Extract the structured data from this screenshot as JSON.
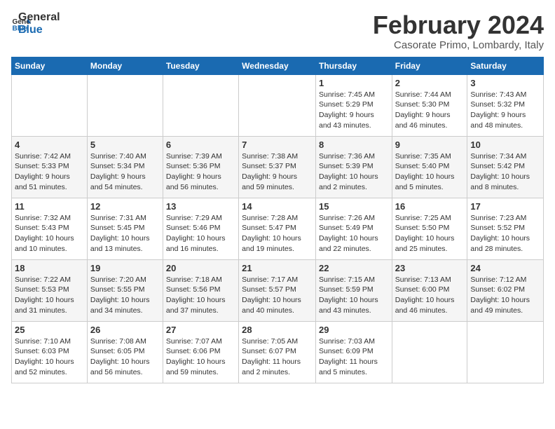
{
  "header": {
    "logo_line1": "General",
    "logo_line2": "Blue",
    "month": "February 2024",
    "location": "Casorate Primo, Lombardy, Italy"
  },
  "weekdays": [
    "Sunday",
    "Monday",
    "Tuesday",
    "Wednesday",
    "Thursday",
    "Friday",
    "Saturday"
  ],
  "weeks": [
    [
      {
        "day": "",
        "info": ""
      },
      {
        "day": "",
        "info": ""
      },
      {
        "day": "",
        "info": ""
      },
      {
        "day": "",
        "info": ""
      },
      {
        "day": "1",
        "info": "Sunrise: 7:45 AM\nSunset: 5:29 PM\nDaylight: 9 hours\nand 43 minutes."
      },
      {
        "day": "2",
        "info": "Sunrise: 7:44 AM\nSunset: 5:30 PM\nDaylight: 9 hours\nand 46 minutes."
      },
      {
        "day": "3",
        "info": "Sunrise: 7:43 AM\nSunset: 5:32 PM\nDaylight: 9 hours\nand 48 minutes."
      }
    ],
    [
      {
        "day": "4",
        "info": "Sunrise: 7:42 AM\nSunset: 5:33 PM\nDaylight: 9 hours\nand 51 minutes."
      },
      {
        "day": "5",
        "info": "Sunrise: 7:40 AM\nSunset: 5:34 PM\nDaylight: 9 hours\nand 54 minutes."
      },
      {
        "day": "6",
        "info": "Sunrise: 7:39 AM\nSunset: 5:36 PM\nDaylight: 9 hours\nand 56 minutes."
      },
      {
        "day": "7",
        "info": "Sunrise: 7:38 AM\nSunset: 5:37 PM\nDaylight: 9 hours\nand 59 minutes."
      },
      {
        "day": "8",
        "info": "Sunrise: 7:36 AM\nSunset: 5:39 PM\nDaylight: 10 hours\nand 2 minutes."
      },
      {
        "day": "9",
        "info": "Sunrise: 7:35 AM\nSunset: 5:40 PM\nDaylight: 10 hours\nand 5 minutes."
      },
      {
        "day": "10",
        "info": "Sunrise: 7:34 AM\nSunset: 5:42 PM\nDaylight: 10 hours\nand 8 minutes."
      }
    ],
    [
      {
        "day": "11",
        "info": "Sunrise: 7:32 AM\nSunset: 5:43 PM\nDaylight: 10 hours\nand 10 minutes."
      },
      {
        "day": "12",
        "info": "Sunrise: 7:31 AM\nSunset: 5:45 PM\nDaylight: 10 hours\nand 13 minutes."
      },
      {
        "day": "13",
        "info": "Sunrise: 7:29 AM\nSunset: 5:46 PM\nDaylight: 10 hours\nand 16 minutes."
      },
      {
        "day": "14",
        "info": "Sunrise: 7:28 AM\nSunset: 5:47 PM\nDaylight: 10 hours\nand 19 minutes."
      },
      {
        "day": "15",
        "info": "Sunrise: 7:26 AM\nSunset: 5:49 PM\nDaylight: 10 hours\nand 22 minutes."
      },
      {
        "day": "16",
        "info": "Sunrise: 7:25 AM\nSunset: 5:50 PM\nDaylight: 10 hours\nand 25 minutes."
      },
      {
        "day": "17",
        "info": "Sunrise: 7:23 AM\nSunset: 5:52 PM\nDaylight: 10 hours\nand 28 minutes."
      }
    ],
    [
      {
        "day": "18",
        "info": "Sunrise: 7:22 AM\nSunset: 5:53 PM\nDaylight: 10 hours\nand 31 minutes."
      },
      {
        "day": "19",
        "info": "Sunrise: 7:20 AM\nSunset: 5:55 PM\nDaylight: 10 hours\nand 34 minutes."
      },
      {
        "day": "20",
        "info": "Sunrise: 7:18 AM\nSunset: 5:56 PM\nDaylight: 10 hours\nand 37 minutes."
      },
      {
        "day": "21",
        "info": "Sunrise: 7:17 AM\nSunset: 5:57 PM\nDaylight: 10 hours\nand 40 minutes."
      },
      {
        "day": "22",
        "info": "Sunrise: 7:15 AM\nSunset: 5:59 PM\nDaylight: 10 hours\nand 43 minutes."
      },
      {
        "day": "23",
        "info": "Sunrise: 7:13 AM\nSunset: 6:00 PM\nDaylight: 10 hours\nand 46 minutes."
      },
      {
        "day": "24",
        "info": "Sunrise: 7:12 AM\nSunset: 6:02 PM\nDaylight: 10 hours\nand 49 minutes."
      }
    ],
    [
      {
        "day": "25",
        "info": "Sunrise: 7:10 AM\nSunset: 6:03 PM\nDaylight: 10 hours\nand 52 minutes."
      },
      {
        "day": "26",
        "info": "Sunrise: 7:08 AM\nSunset: 6:05 PM\nDaylight: 10 hours\nand 56 minutes."
      },
      {
        "day": "27",
        "info": "Sunrise: 7:07 AM\nSunset: 6:06 PM\nDaylight: 10 hours\nand 59 minutes."
      },
      {
        "day": "28",
        "info": "Sunrise: 7:05 AM\nSunset: 6:07 PM\nDaylight: 11 hours\nand 2 minutes."
      },
      {
        "day": "29",
        "info": "Sunrise: 7:03 AM\nSunset: 6:09 PM\nDaylight: 11 hours\nand 5 minutes."
      },
      {
        "day": "",
        "info": ""
      },
      {
        "day": "",
        "info": ""
      }
    ]
  ]
}
